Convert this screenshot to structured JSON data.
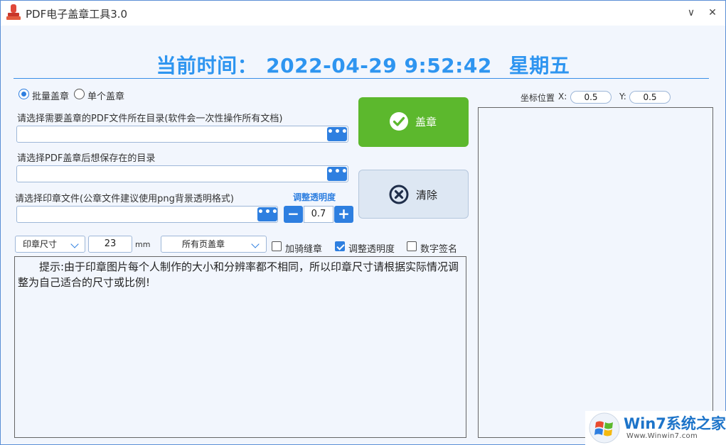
{
  "window": {
    "title": "PDF电子盖章工具3.0",
    "minimize_glyph": "∨",
    "close_glyph": "✕"
  },
  "clock": {
    "label": "当前时间：",
    "datetime": "2022-04-29 9:52:42",
    "weekday": "星期五"
  },
  "mode": {
    "batch_label": "批量盖章",
    "single_label": "单个盖章",
    "selected": "batch"
  },
  "source_dir": {
    "label": "请选择需要盖章的PDF文件所在目录(软件会一次性操作所有文档)",
    "value": "",
    "browse_glyph": "•••"
  },
  "output_dir": {
    "label": "请选择PDF盖章后想保存在的目录",
    "value": "",
    "browse_glyph": "•••"
  },
  "stamp_file": {
    "label": "请选择印章文件(公章文件建议使用png背景透明格式)",
    "value": "",
    "browse_glyph": "•••"
  },
  "opacity": {
    "caption": "调整透明度",
    "value": "0.7",
    "minus_glyph": "−",
    "plus_glyph": "+"
  },
  "actions": {
    "stamp_label": "盖章",
    "clear_label": "清除"
  },
  "options": {
    "size_mode": "印章尺寸",
    "size_value": "23",
    "size_unit": "mm",
    "page_mode": "所有页盖章",
    "seam_label": "加骑缝章",
    "seam_checked": false,
    "opacity_label": "调整透明度",
    "opacity_checked": true,
    "signature_label": "数字签名",
    "signature_checked": false
  },
  "tip": {
    "text": "提示:由于印章图片每个人制作的大小和分辨率都不相同，所以印章尺寸请根据实际情况调整为自己适合的尺寸或比例!"
  },
  "coords": {
    "label": "坐标位置",
    "x_label": "X:",
    "x_value": "0.5",
    "y_label": "Y:",
    "y_value": "0.5"
  },
  "watermark": {
    "brand": "Win7系统之家",
    "url": "Www.Winwin7.com"
  },
  "colors": {
    "accent": "#2e7fe0",
    "clock": "#2e95f0",
    "stamp_button": "#5cb82d"
  }
}
